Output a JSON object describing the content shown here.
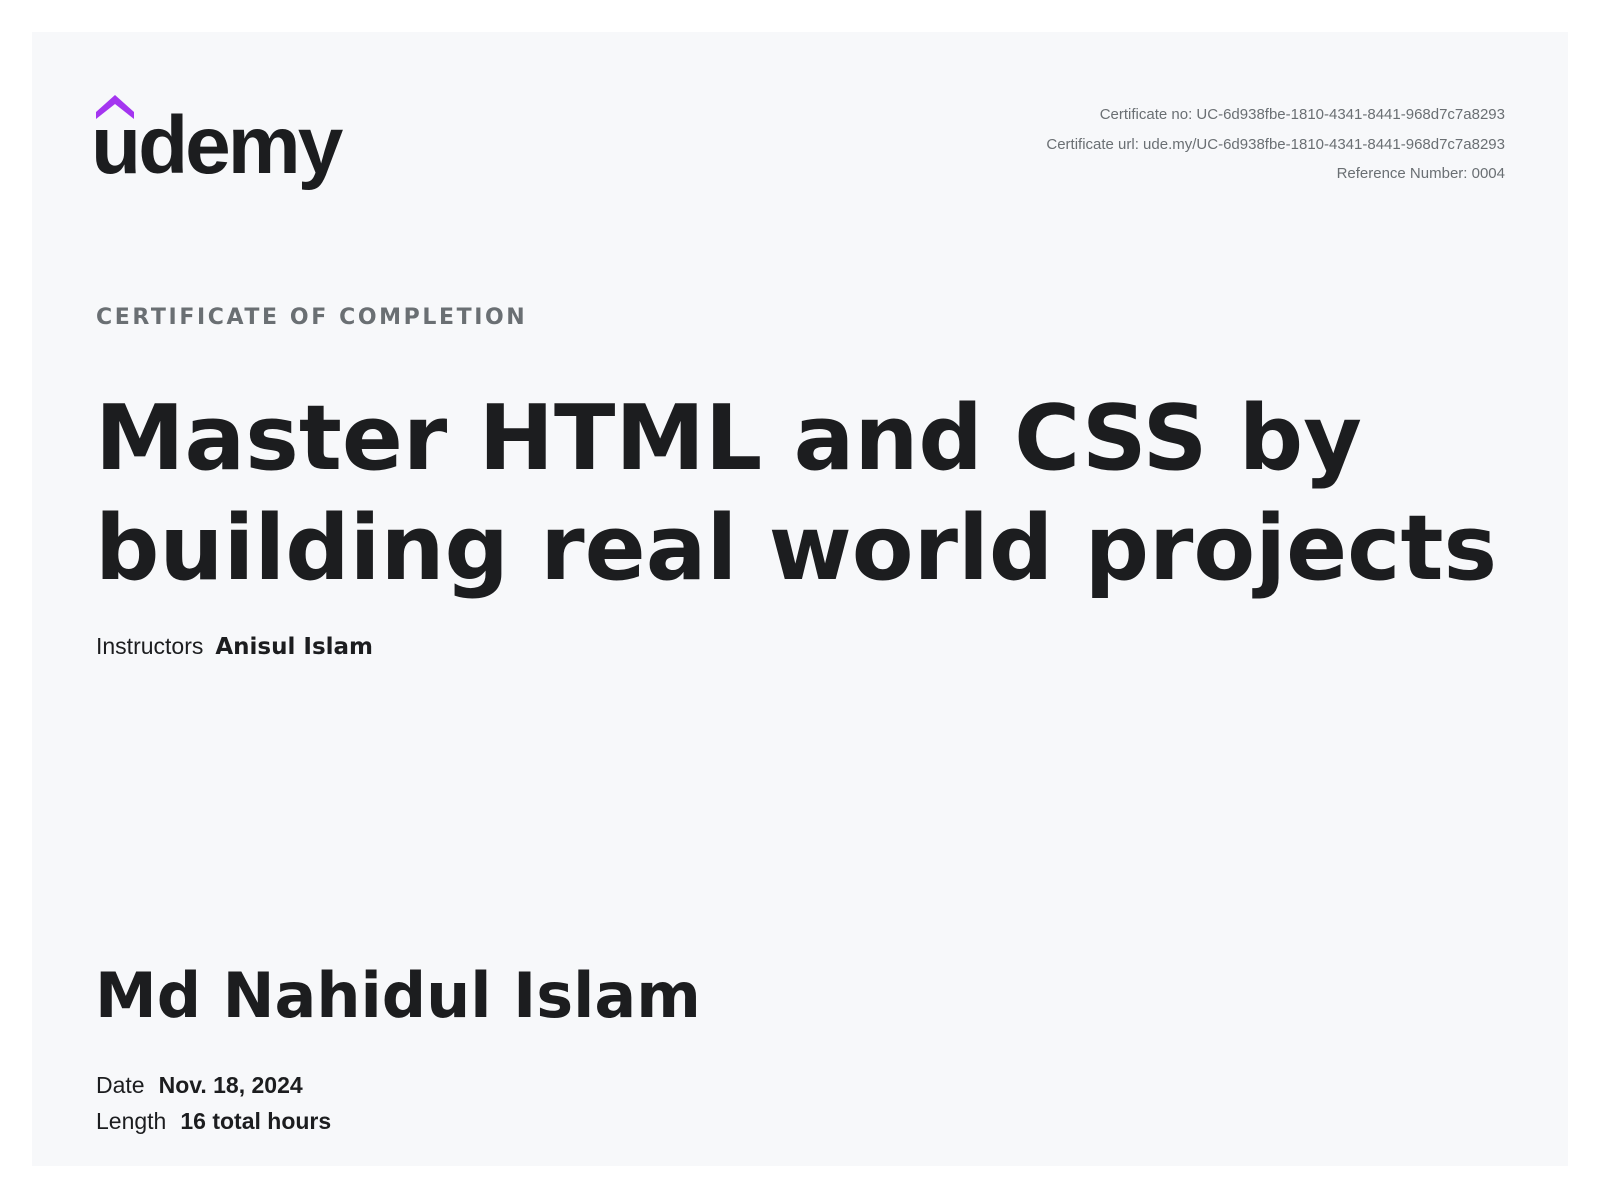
{
  "brand": {
    "name": "udemy",
    "accent_color": "#a435f0",
    "text_color": "#1c1d1f"
  },
  "certificate": {
    "number_line": "Certificate no: UC-6d938fbe-1810-4341-8441-968d7c7a8293",
    "url_line": "Certificate url: ude.my/UC-6d938fbe-1810-4341-8441-968d7c7a8293",
    "reference_line": "Reference Number: 0004"
  },
  "heading": "CERTIFICATE OF COMPLETION",
  "course": {
    "title": "Master HTML and CSS by building real world projects"
  },
  "instructors": {
    "label": "Instructors",
    "names": "Anisul Islam"
  },
  "student": {
    "name": "Md Nahidul Islam"
  },
  "details": {
    "date_label": "Date",
    "date_value": "Nov. 18, 2024",
    "length_label": "Length",
    "length_value": "16 total hours"
  }
}
